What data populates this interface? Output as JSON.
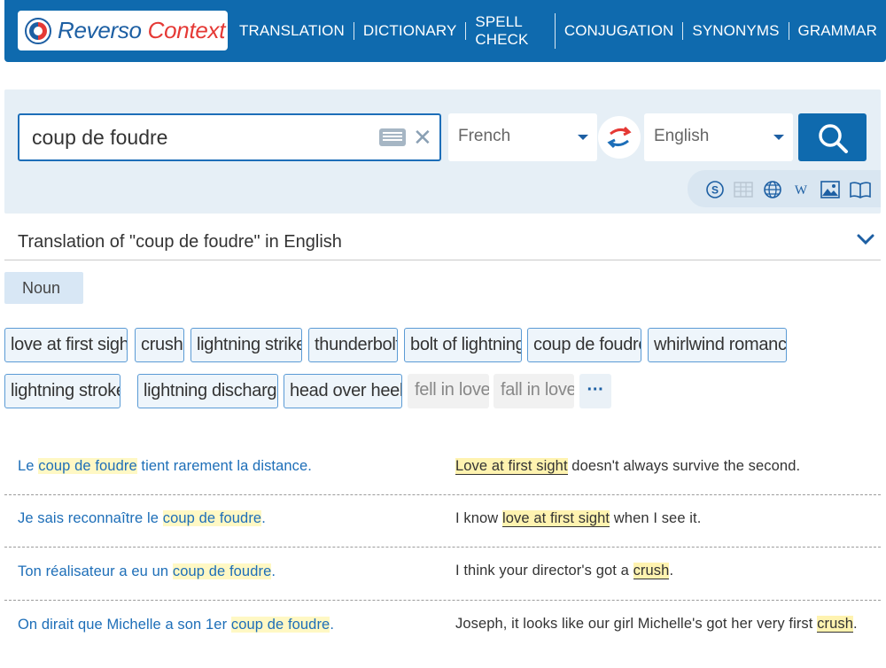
{
  "header": {
    "logo_part1": "Reverso",
    "logo_part2": "Context",
    "nav": [
      "TRANSLATION",
      "DICTIONARY",
      "SPELL CHECK",
      "CONJUGATION",
      "SYNONYMS",
      "GRAMMAR"
    ]
  },
  "search": {
    "query": "coup de foudre",
    "source_lang": "French",
    "target_lang": "English"
  },
  "results": {
    "title": "Translation of \"coup de foudre\" in English",
    "pos_tab": "Noun",
    "translations": [
      {
        "text": "love at first sight",
        "style": "primary"
      },
      {
        "text": "crush",
        "style": "primary"
      },
      {
        "text": "lightning strike",
        "style": "primary"
      },
      {
        "text": "thunderbolt",
        "style": "primary"
      },
      {
        "text": "bolt of lightning",
        "style": "primary"
      },
      {
        "text": "coup de foudre",
        "style": "primary"
      },
      {
        "text": "whirlwind romance",
        "style": "primary"
      },
      {
        "text": "lightning stroke",
        "style": "primary"
      },
      {
        "text": "lightning discharge",
        "style": "primary"
      },
      {
        "text": "head over heels",
        "style": "primary"
      },
      {
        "text": "fell in love",
        "style": "muted"
      },
      {
        "text": "fall in love",
        "style": "muted"
      },
      {
        "text": "···",
        "style": "more"
      }
    ]
  },
  "examples": [
    {
      "src_pre": "Le ",
      "src_hl": "coup de foudre",
      "src_post": " tient rarement la distance.",
      "tgt_pre": "",
      "tgt_hl": "Love at first sight",
      "tgt_post": " doesn't always survive the second."
    },
    {
      "src_pre": "Je sais reconnaître le ",
      "src_hl": "coup de foudre",
      "src_post": ".",
      "tgt_pre": "I know ",
      "tgt_hl": "love at first sight",
      "tgt_post": " when I see it."
    },
    {
      "src_pre": "Ton réalisateur a eu un ",
      "src_hl": "coup de foudre",
      "src_post": ".",
      "tgt_pre": "I think your director's got a ",
      "tgt_hl": "crush",
      "tgt_post": "."
    },
    {
      "src_pre": "On dirait que Michelle a son 1er ",
      "src_hl": "coup de foudre",
      "src_post": ".",
      "tgt_pre": "Joseph, it looks like our girl Michelle's got her very first ",
      "tgt_hl": "crush",
      "tgt_post": "."
    }
  ],
  "colors": {
    "brand_blue": "#0f6aae",
    "chip_border": "#5b9bd5",
    "highlight": "#fff3b0"
  }
}
